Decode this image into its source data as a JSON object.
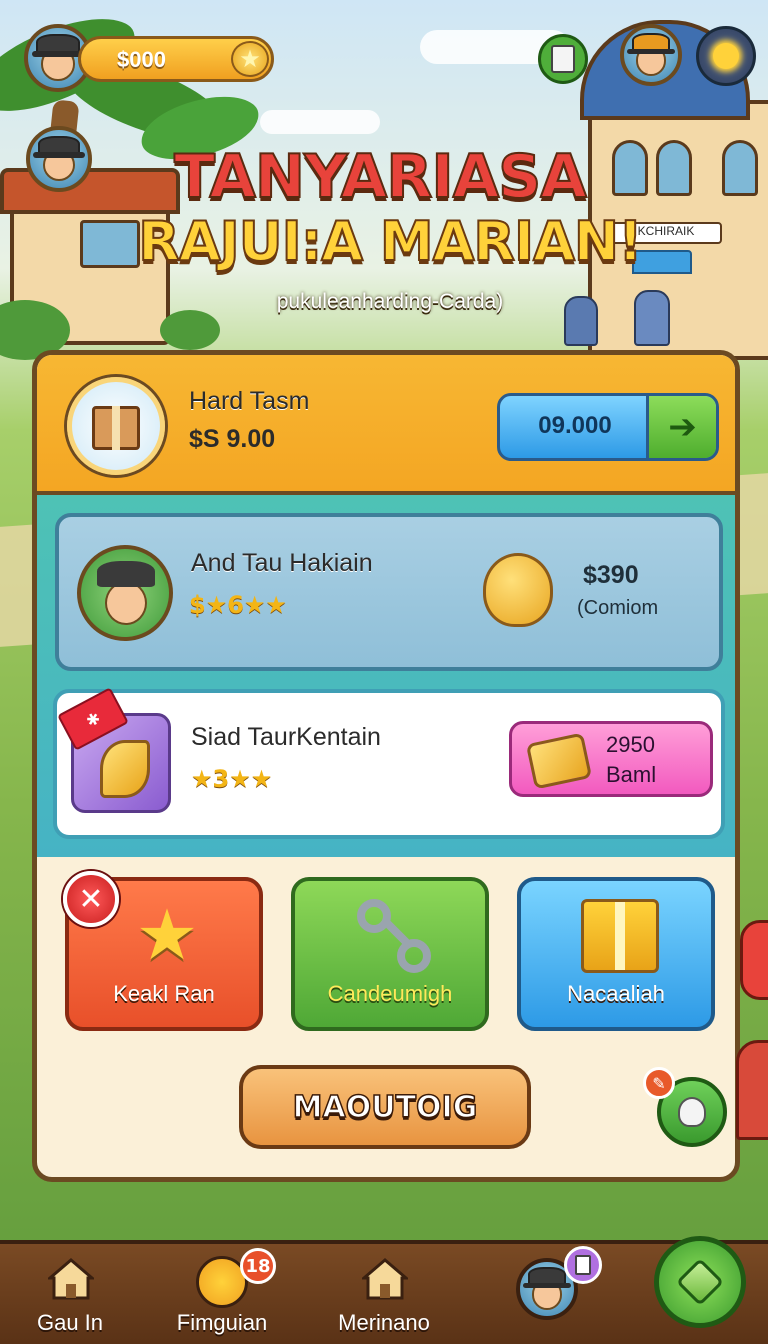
{
  "hud": {
    "coins": "$000",
    "coin_icon": "star-coin-icon",
    "menu_icon": "notepad-icon",
    "settings_icon": "sun-settings-icon"
  },
  "title": {
    "line1": "TANYARIASA",
    "line2": "RAJUI:A MARIAN!",
    "subtitle": "pukuleanharding-Carda)",
    "building_sign": "KCHIRAIK"
  },
  "shop": {
    "featured": {
      "name": "Hard Tasm",
      "price": "$S 9.00",
      "button_value": "09.000",
      "button_icon": "arrow-right-icon"
    },
    "item2": {
      "name": "And Tau Hakiain",
      "stars": "$★6★★",
      "reward_amount": "$390",
      "reward_note": "(Comiom"
    },
    "item3": {
      "name": "Siad TaurKentain",
      "stars": "★3★★",
      "button_line1": "2950",
      "button_line2": "Baml"
    }
  },
  "actions": [
    {
      "label": "Keakl Ran",
      "icon": "star-trophy-icon",
      "color": "#e8502a"
    },
    {
      "label": "Candeumigh",
      "icon": "link-icon",
      "color": "#4fa836"
    },
    {
      "label": "Nacaaliah",
      "icon": "gift-icon",
      "color": "#2d9ae6"
    }
  ],
  "main_button": "MAOUTOIG",
  "nav": {
    "items": [
      {
        "label": "Gau In",
        "icon": "home-icon"
      },
      {
        "label": "Fimguian",
        "icon": "chick-icon",
        "badge": "18"
      },
      {
        "label": "Merinano",
        "icon": "home-icon"
      },
      {
        "label": "",
        "icon": "profile-icon"
      }
    ],
    "play_icon": "diamond-icon"
  }
}
